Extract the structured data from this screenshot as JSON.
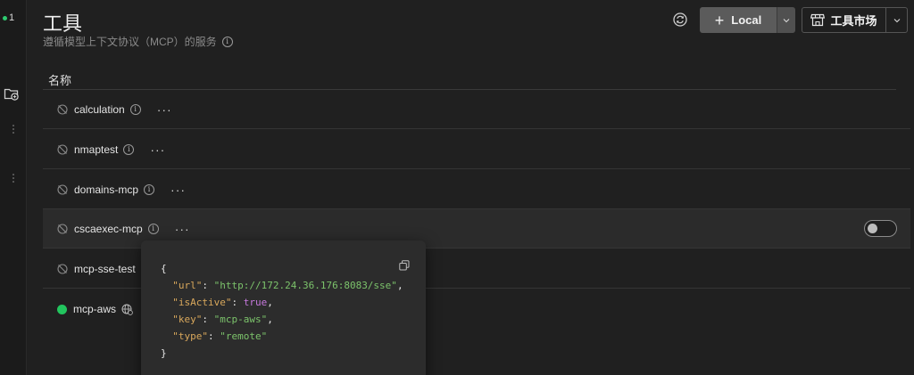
{
  "rail": {
    "status_count": "1"
  },
  "header": {
    "title": "工具",
    "subtitle": "遵循模型上下文协议（MCP）的服务",
    "local_label": "Local",
    "market_label": "工具市场"
  },
  "table": {
    "col_name": "名称"
  },
  "rows": [
    {
      "name": "calculation",
      "status": "inactive"
    },
    {
      "name": "nmaptest",
      "status": "inactive"
    },
    {
      "name": "domains-mcp",
      "status": "inactive"
    },
    {
      "name": "cscaexec-mcp",
      "status": "inactive"
    },
    {
      "name": "mcp-sse-test",
      "status": "inactive"
    },
    {
      "name": "mcp-aws",
      "status": "active"
    }
  ],
  "popup": {
    "open": "{",
    "close": "}",
    "entries": [
      {
        "key": "\"url\"",
        "value": "\"http://172.24.36.176:8083/sse\"",
        "kind": "string",
        "comma": ","
      },
      {
        "key": "\"isActive\"",
        "value": "true",
        "kind": "bool",
        "comma": ","
      },
      {
        "key": "\"key\"",
        "value": "\"mcp-aws\"",
        "kind": "string",
        "comma": ","
      },
      {
        "key": "\"type\"",
        "value": "\"remote\"",
        "kind": "string",
        "comma": ""
      }
    ]
  },
  "colors": {
    "accent_green": "#22c55e",
    "button_gray": "#5b5b5b",
    "json_key": "#d9a85c",
    "json_string": "#7cc36b",
    "json_bool": "#c678dd"
  }
}
